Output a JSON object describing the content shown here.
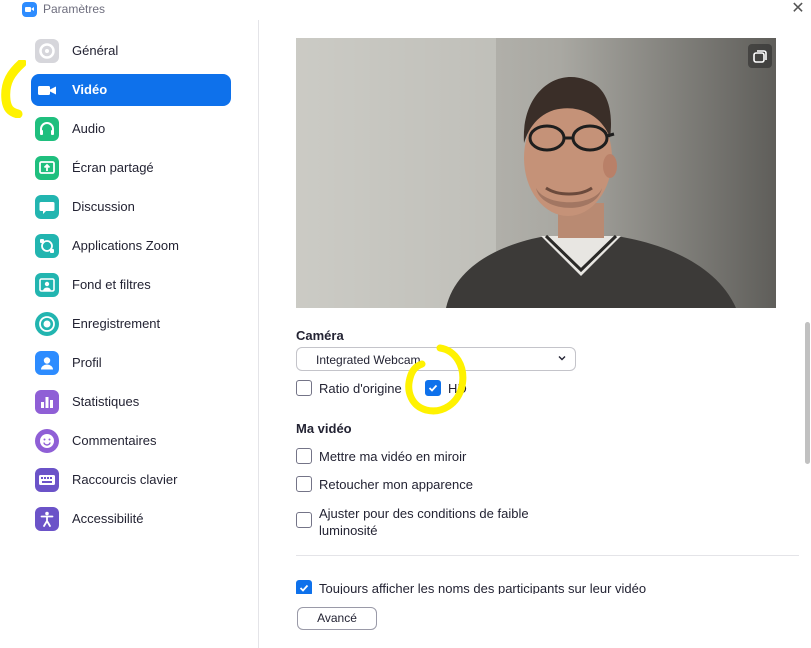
{
  "window": {
    "title": "Paramètres"
  },
  "sidebar": {
    "items": [
      {
        "label": "Général",
        "icon": "gear-icon",
        "color": "#c9c9cf"
      },
      {
        "label": "Vidéo",
        "icon": "video-camera-icon",
        "color": "#ffffff",
        "active": true
      },
      {
        "label": "Audio",
        "icon": "headphones-icon",
        "color": "#1fbf7e"
      },
      {
        "label": "Écran partagé",
        "icon": "share-screen-icon",
        "color": "#1fbf7e"
      },
      {
        "label": "Discussion",
        "icon": "chat-bubble-icon",
        "color": "#22b5b0"
      },
      {
        "label": "Applications Zoom",
        "icon": "apps-icon",
        "color": "#22b5b0"
      },
      {
        "label": "Fond et filtres",
        "icon": "background-icon",
        "color": "#22b5b0"
      },
      {
        "label": "Enregistrement",
        "icon": "record-icon",
        "color": "#22b5b0"
      },
      {
        "label": "Profil",
        "icon": "profile-icon",
        "color": "#2d8cff"
      },
      {
        "label": "Statistiques",
        "icon": "statistics-icon",
        "color": "#8f5fd6"
      },
      {
        "label": "Commentaires",
        "icon": "feedback-icon",
        "color": "#8f5fd6"
      },
      {
        "label": "Raccourcis clavier",
        "icon": "keyboard-icon",
        "color": "#6b53c8"
      },
      {
        "label": "Accessibilité",
        "icon": "accessibility-icon",
        "color": "#6b53c8"
      }
    ]
  },
  "camera": {
    "title": "Caméra",
    "selected": "Integrated Webcam",
    "ratio_label": "Ratio d'origine",
    "ratio_checked": false,
    "hd_label": "HD",
    "hd_checked": true
  },
  "my_video": {
    "title": "Ma vidéo",
    "mirror_label": "Mettre ma vidéo en miroir",
    "touchup_label": "Retoucher mon apparence",
    "lowlight_label_line1": "Ajuster pour des conditions de faible",
    "lowlight_label_line2": "luminosité"
  },
  "participants_names_label": "Toujours afficher les noms des participants sur leur vidéo",
  "advanced_button": "Avancé",
  "colors": {
    "accent": "#0e71eb",
    "highlight": "#fff200"
  }
}
